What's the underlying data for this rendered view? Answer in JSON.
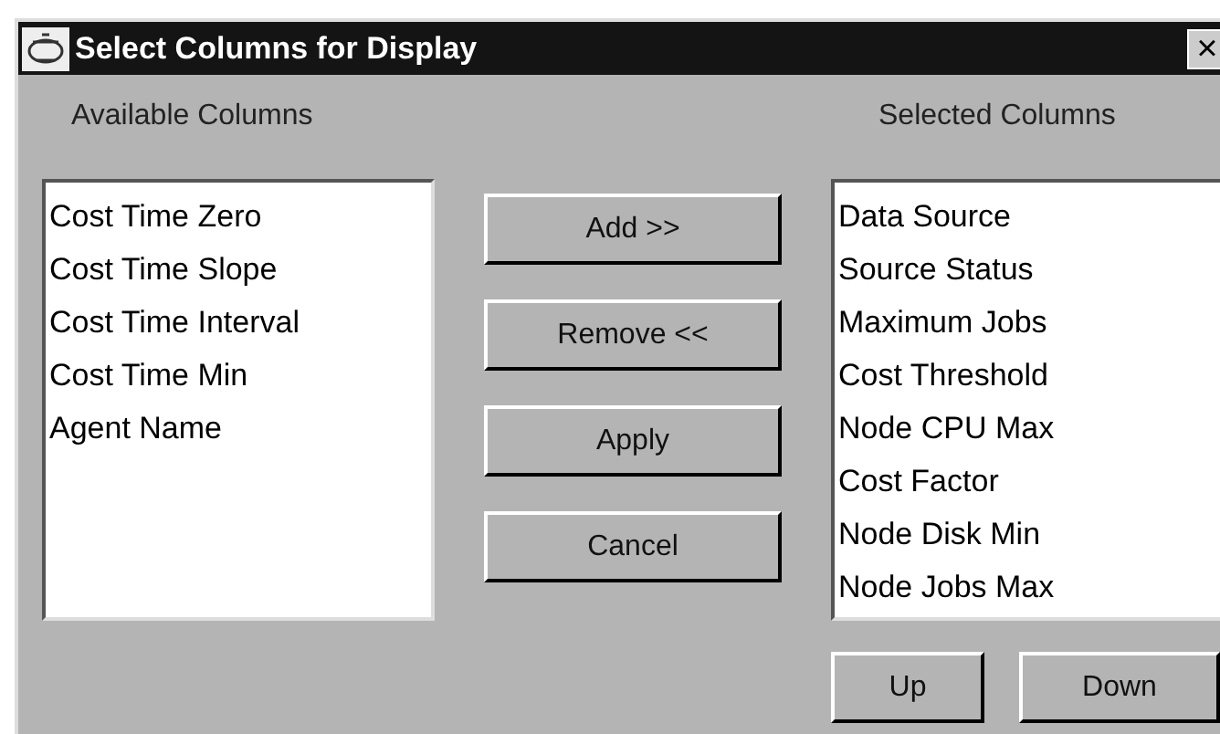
{
  "window": {
    "title": "Select Columns for Display",
    "close": "×"
  },
  "available": {
    "label": "Available Columns",
    "items": [
      "Cost Time Zero",
      "Cost Time Slope",
      "Cost Time Interval",
      "Cost Time Min",
      "Agent Name"
    ]
  },
  "selected": {
    "label": "Selected Columns",
    "items": [
      "Data Source",
      "Source Status",
      "Maximum Jobs",
      "Cost Threshold",
      "Node CPU Max",
      "Cost Factor",
      "Node Disk Min",
      "Node Jobs Max"
    ]
  },
  "buttons": [
    "Add >>",
    "Remove <<",
    "Apply",
    "Cancel"
  ],
  "order_buttons": [
    "Up",
    "Down"
  ]
}
